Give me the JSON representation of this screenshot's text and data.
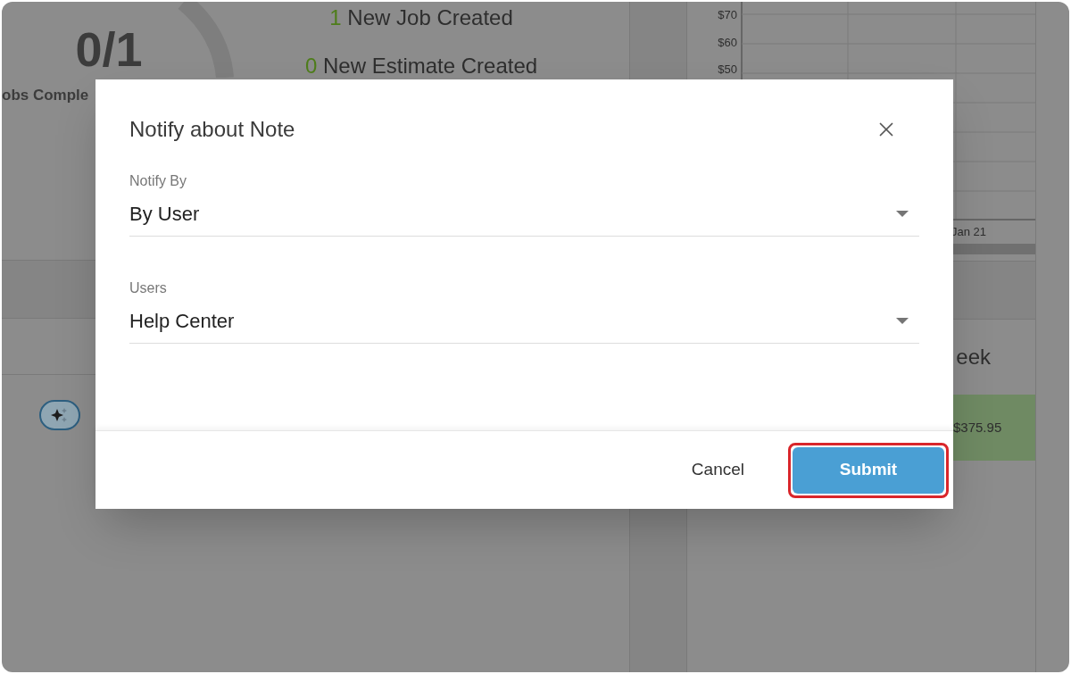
{
  "background": {
    "jobs_ratio": "0/1",
    "jobs_label": "obs Comple",
    "stats": [
      {
        "count": "1",
        "label": "New Job Created"
      },
      {
        "count": "0",
        "label": "New Estimate Created"
      }
    ],
    "chart_yticks": [
      "$70",
      "$60",
      "$50"
    ],
    "chart_xlabel": "Jan 21",
    "week_heading": "eek",
    "amount": "$375.95"
  },
  "dialog": {
    "title": "Notify about Note",
    "fields": [
      {
        "label": "Notify By",
        "value": "By User"
      },
      {
        "label": "Users",
        "value": "Help Center"
      }
    ],
    "buttons": [
      {
        "label": "Cancel",
        "kind": "text",
        "highlighted": false
      },
      {
        "label": "Submit",
        "kind": "primary",
        "highlighted": true
      }
    ]
  }
}
